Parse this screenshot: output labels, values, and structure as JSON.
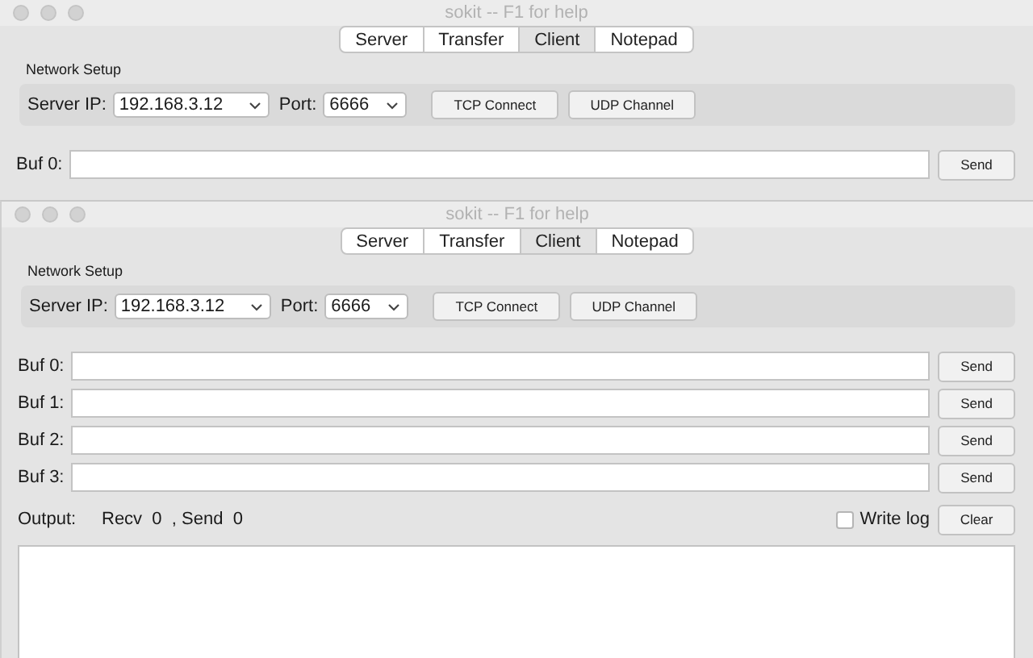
{
  "windows": [
    {
      "title": "sokit -- F1 for help",
      "active": false,
      "tabs": [
        {
          "label": "Server",
          "selected": false
        },
        {
          "label": "Transfer",
          "selected": false
        },
        {
          "label": "Client",
          "selected": true
        },
        {
          "label": "Notepad",
          "selected": false
        }
      ],
      "network_setup": {
        "label": "Network Setup",
        "server_ip_label": "Server IP:",
        "server_ip": "192.168.3.12",
        "port_label": "Port:",
        "port": "6666",
        "buttons": [
          "TCP Connect",
          "UDP Channel"
        ]
      },
      "buffers": [
        {
          "label": "Buf 0:",
          "button": "Send"
        }
      ]
    },
    {
      "title": "sokit -- F1 for help",
      "active": false,
      "tabs": [
        {
          "label": "Server",
          "selected": false
        },
        {
          "label": "Transfer",
          "selected": false
        },
        {
          "label": "Client",
          "selected": true
        },
        {
          "label": "Notepad",
          "selected": false
        }
      ],
      "network_setup": {
        "label": "Network Setup",
        "server_ip_label": "Server IP:",
        "server_ip": "192.168.3.12",
        "port_label": "Port:",
        "port": "6666",
        "buttons": [
          "TCP Connect",
          "UDP Channel"
        ]
      },
      "buffers": [
        {
          "label": "Buf 0:",
          "button": "Send"
        },
        {
          "label": "Buf 1:",
          "button": "Send"
        },
        {
          "label": "Buf 2:",
          "button": "Send"
        },
        {
          "label": "Buf 3:",
          "button": "Send"
        }
      ],
      "output": {
        "label": "Output:",
        "counts": "Recv  0  , Send  0",
        "write_log": {
          "label": "Write log",
          "checked": false
        },
        "clear_button": "Clear"
      }
    }
  ]
}
